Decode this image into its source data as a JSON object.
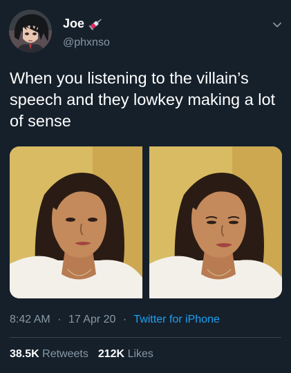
{
  "user": {
    "display_name": "Joe",
    "handle": "@phxnso",
    "name_emoji": "syringe-emoji"
  },
  "tweet": {
    "text": "When you listening to the villain’s speech and they lowkey making a lot of sense"
  },
  "media": {
    "count": 2
  },
  "meta": {
    "time": "8:42 AM",
    "separator": "·",
    "date": "17 Apr 20",
    "source": "Twitter for iPhone"
  },
  "stats": {
    "retweets_count": "38.5K",
    "retweets_label": "Retweets",
    "likes_count": "212K",
    "likes_label": "Likes"
  },
  "colors": {
    "background": "#15202b",
    "secondary_text": "#8899a6",
    "link": "#1da1f2",
    "divider": "#38444d"
  },
  "icons": {
    "menu": "chevron-down-icon"
  }
}
